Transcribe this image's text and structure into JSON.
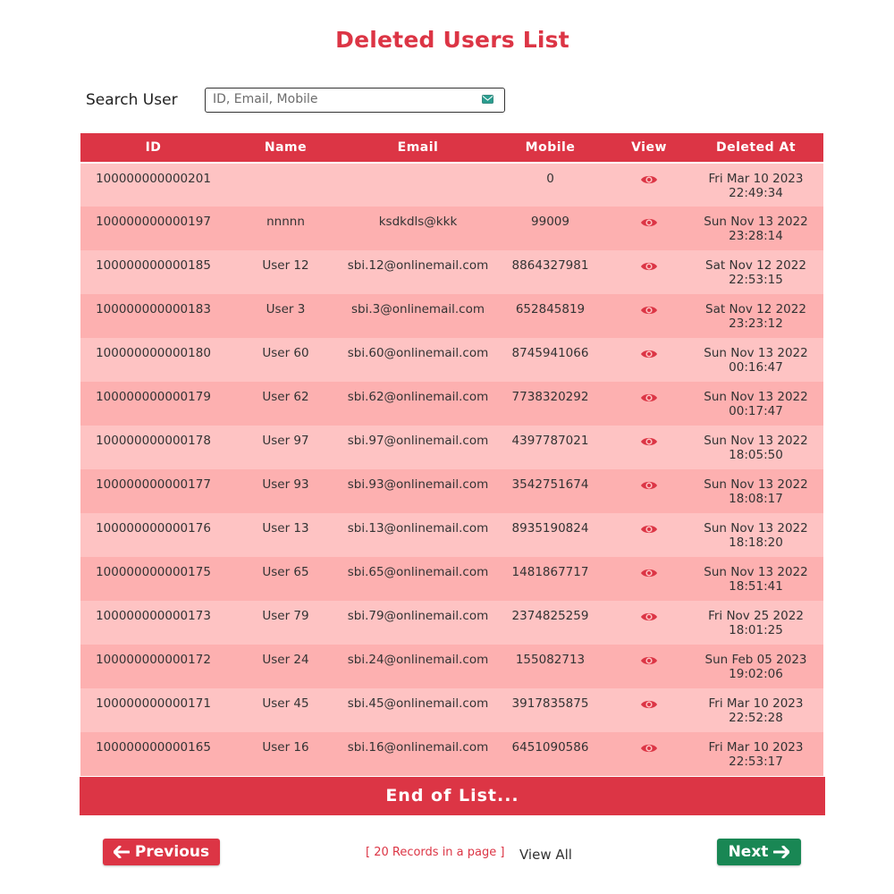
{
  "page": {
    "title": "Deleted Users List"
  },
  "search": {
    "label": "Search User",
    "placeholder": "ID, Email, Mobile"
  },
  "table": {
    "headers": [
      "ID",
      "Name",
      "Email",
      "Mobile",
      "View",
      "Deleted At"
    ],
    "rows": [
      {
        "id": "100000000000201",
        "name": "",
        "email": "",
        "mobile": "0",
        "deleted_at": "Fri Mar 10 2023\n22:49:34"
      },
      {
        "id": "100000000000197",
        "name": "nnnnn",
        "email": "ksdkdls@kkk",
        "mobile": "99009",
        "deleted_at": "Sun Nov 13 2022\n23:28:14"
      },
      {
        "id": "100000000000185",
        "name": "User 12",
        "email": "sbi.12@onlinemail.com",
        "mobile": "8864327981",
        "deleted_at": "Sat Nov 12 2022\n22:53:15"
      },
      {
        "id": "100000000000183",
        "name": "User 3",
        "email": "sbi.3@onlinemail.com",
        "mobile": "652845819",
        "deleted_at": "Sat Nov 12 2022\n23:23:12"
      },
      {
        "id": "100000000000180",
        "name": "User 60",
        "email": "sbi.60@onlinemail.com",
        "mobile": "8745941066",
        "deleted_at": "Sun Nov 13 2022\n00:16:47"
      },
      {
        "id": "100000000000179",
        "name": "User 62",
        "email": "sbi.62@onlinemail.com",
        "mobile": "7738320292",
        "deleted_at": "Sun Nov 13 2022\n00:17:47"
      },
      {
        "id": "100000000000178",
        "name": "User 97",
        "email": "sbi.97@onlinemail.com",
        "mobile": "4397787021",
        "deleted_at": "Sun Nov 13 2022\n18:05:50"
      },
      {
        "id": "100000000000177",
        "name": "User 93",
        "email": "sbi.93@onlinemail.com",
        "mobile": "3542751674",
        "deleted_at": "Sun Nov 13 2022\n18:08:17"
      },
      {
        "id": "100000000000176",
        "name": "User 13",
        "email": "sbi.13@onlinemail.com",
        "mobile": "8935190824",
        "deleted_at": "Sun Nov 13 2022\n18:18:20"
      },
      {
        "id": "100000000000175",
        "name": "User 65",
        "email": "sbi.65@onlinemail.com",
        "mobile": "1481867717",
        "deleted_at": "Sun Nov 13 2022\n18:51:41"
      },
      {
        "id": "100000000000173",
        "name": "User 79",
        "email": "sbi.79@onlinemail.com",
        "mobile": "2374825259",
        "deleted_at": "Fri Nov 25 2022\n18:01:25"
      },
      {
        "id": "100000000000172",
        "name": "User 24",
        "email": "sbi.24@onlinemail.com",
        "mobile": "155082713",
        "deleted_at": "Sun Feb 05 2023\n19:02:06"
      },
      {
        "id": "100000000000171",
        "name": "User 45",
        "email": "sbi.45@onlinemail.com",
        "mobile": "3917835875",
        "deleted_at": "Fri Mar 10 2023\n22:52:28"
      },
      {
        "id": "100000000000165",
        "name": "User 16",
        "email": "sbi.16@onlinemail.com",
        "mobile": "6451090586",
        "deleted_at": "Fri Mar 10 2023\n22:53:17"
      }
    ],
    "end_label": "End of List..."
  },
  "pagination": {
    "previous_label": "Previous",
    "next_label": "Next",
    "records_info": "[ 20 Records in a page ]",
    "view_all_label": "View All"
  },
  "icons": {
    "search": "envelope-icon",
    "view": "eye-icon",
    "previous": "arrow-left-icon",
    "next": "arrow-right-icon"
  },
  "colors": {
    "accent": "#dc3545",
    "row_odd": "#fec3c3",
    "row_even": "#fdb0b0",
    "next_button": "#198754"
  }
}
